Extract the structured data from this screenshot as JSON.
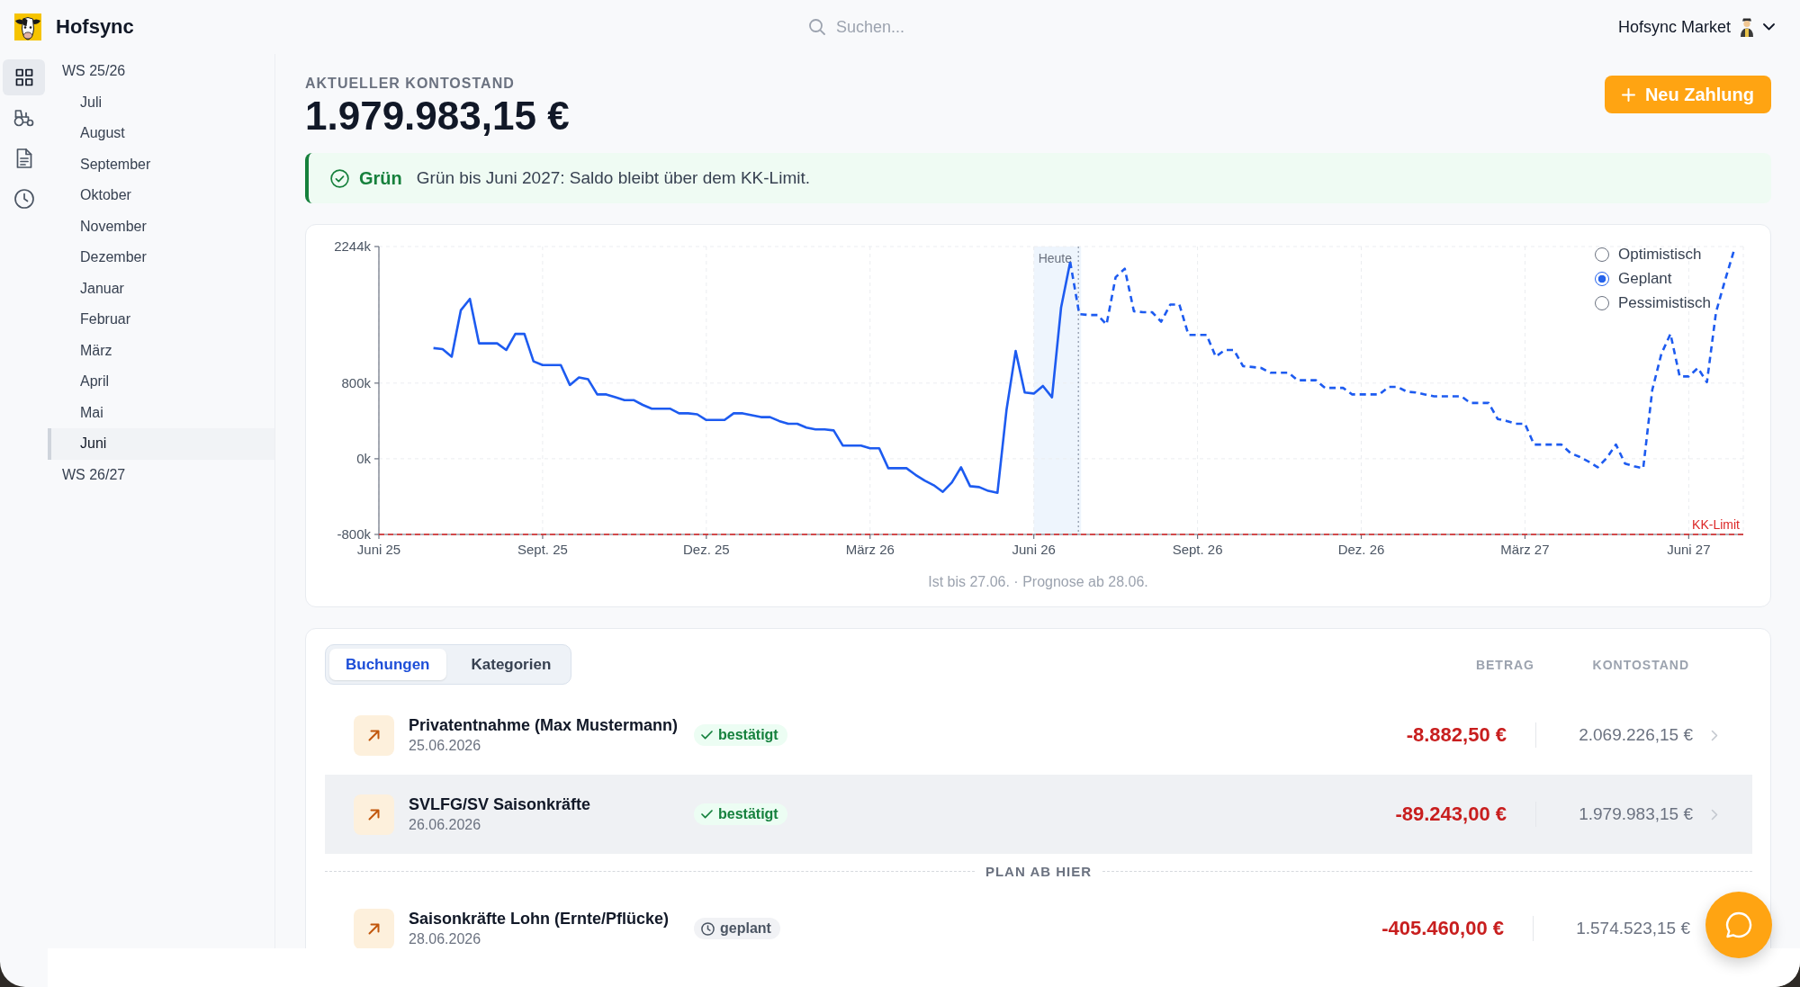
{
  "header": {
    "app_name": "Hofsync",
    "search": {
      "placeholder": "Suchen..."
    },
    "user": {
      "name": "Hofsync Market"
    }
  },
  "nav_rail": {
    "items": [
      {
        "selected": true
      },
      {
        "selected": false
      },
      {
        "selected": false
      },
      {
        "selected": false
      }
    ]
  },
  "sidebar": {
    "items": [
      {
        "label": "WS 25/26",
        "selected": false,
        "children": [
          {
            "label": "Juli",
            "selected": false
          },
          {
            "label": "August",
            "selected": false
          },
          {
            "label": "September",
            "selected": false
          },
          {
            "label": "Oktober",
            "selected": false
          },
          {
            "label": "November",
            "selected": false
          },
          {
            "label": "Dezember",
            "selected": false
          },
          {
            "label": "Januar",
            "selected": false
          },
          {
            "label": "Februar",
            "selected": false
          },
          {
            "label": "März",
            "selected": false
          },
          {
            "label": "April",
            "selected": false
          },
          {
            "label": "Mai",
            "selected": false
          },
          {
            "label": "Juni",
            "selected": true
          }
        ]
      },
      {
        "label": "WS 26/27",
        "selected": false
      }
    ]
  },
  "balance": {
    "label": "AKTUELLER KONTOSTAND",
    "amount": "1.979.983,15 €"
  },
  "new_payment_button": {
    "label": "Neu Zahlung"
  },
  "alert": {
    "kind": "success",
    "status": "Grün",
    "message": "Grün bis Juni 2027: Saldo bleibt über dem KK-Limit."
  },
  "chart": {
    "scenarios": [
      {
        "label": "Optimistisch",
        "selected": false
      },
      {
        "label": "Geplant",
        "selected": true
      },
      {
        "label": "Pessimistisch",
        "selected": false
      }
    ],
    "today_label": "Heute",
    "chart_data": {
      "type": "line",
      "categories": [
        "Juni 25",
        null,
        null,
        null,
        null,
        null,
        null,
        null,
        null,
        null,
        null,
        null,
        null,
        null,
        null,
        null,
        null,
        null,
        "Sept. 25",
        null,
        null,
        null,
        null,
        null,
        null,
        null,
        null,
        null,
        null,
        null,
        null,
        null,
        null,
        null,
        null,
        null,
        "Dez. 25",
        null,
        null,
        null,
        null,
        null,
        null,
        null,
        null,
        null,
        null,
        null,
        null,
        null,
        null,
        null,
        null,
        null,
        "März 26",
        null,
        null,
        null,
        null,
        null,
        null,
        null,
        null,
        null,
        null,
        null,
        null,
        null,
        null,
        null,
        null,
        null,
        "Juni 26",
        null,
        null,
        null,
        null,
        null,
        null,
        null,
        null,
        null,
        null,
        null,
        null,
        null,
        null,
        null,
        null,
        null,
        "Sept. 26",
        null,
        null,
        null,
        null,
        null,
        null,
        null,
        null,
        null,
        null,
        null,
        null,
        null,
        null,
        null,
        null,
        null,
        "Dez. 26",
        null,
        null,
        null,
        null,
        null,
        null,
        null,
        null,
        null,
        null,
        null,
        null,
        null,
        null,
        null,
        null,
        null,
        "März 27",
        null,
        null,
        null,
        null,
        null,
        null,
        null,
        null,
        null,
        null,
        null,
        null,
        null,
        null,
        null,
        null,
        null,
        "Juni 27",
        null,
        null,
        null,
        null,
        null,
        null
      ],
      "series": [
        {
          "color": "#1d5bf0",
          "values": [
            null,
            null,
            null,
            null,
            null,
            null,
            1170,
            1160,
            1080,
            1570,
            1690,
            1220,
            1220,
            1220,
            1150,
            1320,
            1320,
            1030,
            990,
            990,
            990,
            780,
            860,
            840,
            680,
            680,
            650,
            620,
            620,
            570,
            530,
            530,
            530,
            480,
            480,
            470,
            410,
            410,
            410,
            480,
            480,
            460,
            440,
            440,
            400,
            370,
            370,
            330,
            310,
            310,
            300,
            140,
            140,
            140,
            110,
            110,
            -100,
            -100,
            -100,
            -170,
            -230,
            -280,
            -350,
            -250,
            -90,
            -290,
            -300,
            -340,
            -360,
            520,
            1140,
            700,
            690,
            770,
            650,
            1600,
            2080,
            1530,
            1520,
            1520,
            1420,
            1920,
            2010,
            1560,
            1550,
            1550,
            1450,
            1630,
            1630,
            1310,
            1310,
            1310,
            1080,
            1150,
            1150,
            980,
            970,
            960,
            910,
            910,
            910,
            830,
            830,
            830,
            750,
            750,
            750,
            680,
            680,
            680,
            680,
            760,
            760,
            710,
            700,
            680,
            660,
            660,
            660,
            660,
            590,
            590,
            590,
            420,
            400,
            370,
            370,
            150,
            150,
            150,
            150,
            60,
            20,
            -30,
            -90,
            10,
            150,
            -50,
            -80,
            -100,
            730,
            1110,
            1320,
            870,
            870,
            960,
            810,
            1550,
            1890,
            2210,
            null
          ]
        }
      ],
      "ylim": [
        -800,
        2244
      ],
      "yticks": [
        {
          "value": -800,
          "label": "-800k"
        },
        {
          "value": 0,
          "label": "0k"
        },
        {
          "value": 800,
          "label": "800k"
        },
        {
          "value": 2244,
          "label": "2244k"
        }
      ],
      "ref_lines": [
        {
          "axis": "y",
          "value": -800,
          "label": "KK-Limit"
        }
      ]
    },
    "note": "Ist bis 27.06. · Prognose ab 28.06."
  },
  "bookings": {
    "tabs": [
      {
        "label": "Buchungen",
        "selected": true
      },
      {
        "label": "Kategorien",
        "selected": false
      }
    ],
    "columns": [
      "BETRAG",
      "KONTOSTAND"
    ],
    "rows": [
      {
        "kind": "transaction",
        "selected": false,
        "title": "Privatentnahme (Max Mustermann)",
        "date": "25.06.2026",
        "status": {
          "kind": "confirmed",
          "label": "bestätigt"
        },
        "amount": "-8.882,50 €",
        "balance": "2.069.226,15 €"
      },
      {
        "kind": "transaction",
        "selected": true,
        "title": "SVLFG/SV Saisonkräfte",
        "date": "26.06.2026",
        "status": {
          "kind": "confirmed",
          "label": "bestätigt"
        },
        "amount": "-89.243,00 €",
        "balance": "1.979.983,15 €"
      },
      {
        "kind": "divider",
        "label": "PLAN AB HIER"
      },
      {
        "kind": "transaction",
        "selected": false,
        "title": "Saisonkräfte Lohn (Ernte/Pflücke)",
        "date": "28.06.2026",
        "status": {
          "kind": "planned",
          "label": "geplant"
        },
        "amount": "-405.460,00 €",
        "balance": "1.574.523,15 €"
      }
    ]
  }
}
